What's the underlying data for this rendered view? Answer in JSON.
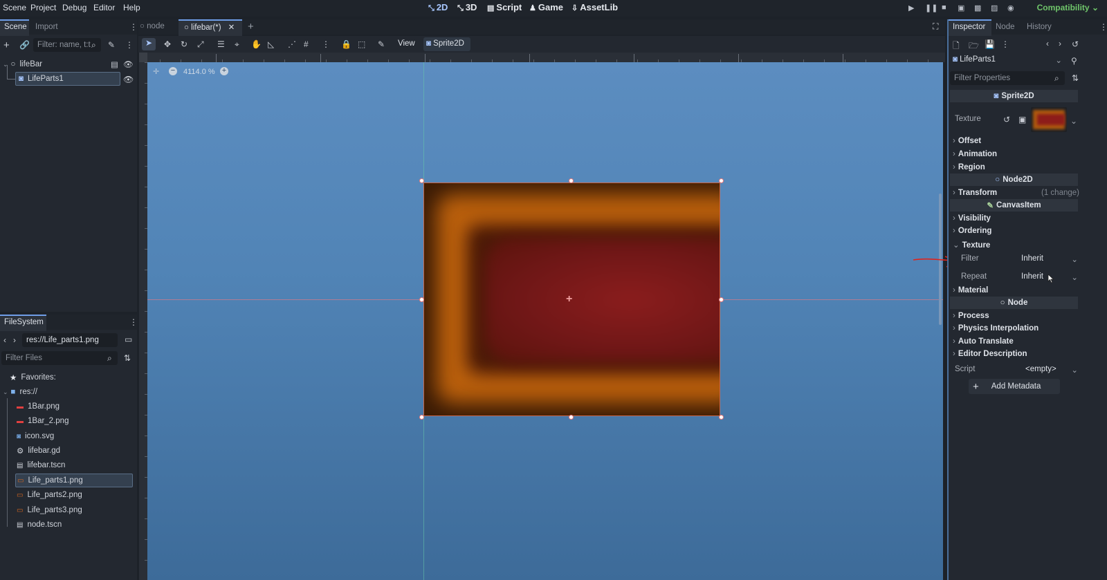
{
  "menu": [
    "Scene",
    "Project",
    "Debug",
    "Editor",
    "Help"
  ],
  "workspaces": [
    {
      "label": "2D",
      "icon": "2d-icon",
      "active": true
    },
    {
      "label": "3D",
      "icon": "3d-icon",
      "active": false
    },
    {
      "label": "Script",
      "icon": "script-icon",
      "active": false
    },
    {
      "label": "Game",
      "icon": "game-icon",
      "active": false
    },
    {
      "label": "AssetLib",
      "icon": "assetlib-icon",
      "active": false
    }
  ],
  "renderer": "Compatibility",
  "scene_dock": {
    "tabs": [
      "Scene",
      "Import"
    ],
    "filter_placeholder": "Filter: name, t:t",
    "tree": [
      {
        "label": "lifeBar",
        "icon": "node-icon",
        "level": 0
      },
      {
        "label": "LifeParts1",
        "icon": "sprite2d-icon",
        "level": 1,
        "selected": true
      }
    ]
  },
  "filesystem": {
    "tab": "FileSystem",
    "path": "res://Life_parts1.png",
    "filter_placeholder": "Filter Files",
    "favorites_label": "Favorites:",
    "root_label": "res://",
    "files": [
      {
        "name": "1Bar.png",
        "icon": "image-icon"
      },
      {
        "name": "1Bar_2.png",
        "icon": "image-icon"
      },
      {
        "name": "icon.svg",
        "icon": "svg-icon"
      },
      {
        "name": "lifebar.gd",
        "icon": "gear-icon"
      },
      {
        "name": "lifebar.tscn",
        "icon": "scene-icon"
      },
      {
        "name": "Life_parts1.png",
        "icon": "image-icon",
        "selected": true
      },
      {
        "name": "Life_parts2.png",
        "icon": "image-icon"
      },
      {
        "name": "Life_parts3.png",
        "icon": "image-icon"
      },
      {
        "name": "node.tscn",
        "icon": "scene-icon"
      }
    ]
  },
  "editor_tabs": [
    {
      "label": "node",
      "active": false
    },
    {
      "label": "lifebar(*)",
      "active": true
    }
  ],
  "toolbar": {
    "view_label": "View",
    "node_label": "Sprite2D"
  },
  "zoom": {
    "value": "4114.0 %"
  },
  "inspector": {
    "tabs": [
      "Inspector",
      "Node",
      "History"
    ],
    "node_name": "LifeParts1",
    "filter_placeholder": "Filter Properties",
    "sections": {
      "sprite2d": "Sprite2D",
      "node2d": "Node2D",
      "canvasitem": "CanvasItem",
      "node": "Node"
    },
    "texture_label": "Texture",
    "groups": {
      "offset": "Offset",
      "animation": "Animation",
      "region": "Region",
      "transform": "Transform",
      "transform_note": "(1 change)",
      "visibility": "Visibility",
      "ordering": "Ordering",
      "texture": "Texture",
      "material": "Material",
      "process": "Process",
      "physics_interpolation": "Physics Interpolation",
      "auto_translate": "Auto Translate",
      "editor_description": "Editor Description"
    },
    "filter_label": "Filter",
    "filter_value": "Inherit",
    "repeat_label": "Repeat",
    "repeat_value": "Inherit",
    "script_label": "Script",
    "script_value": "<empty>",
    "add_metadata_label": "Add Metadata"
  },
  "colors": {
    "accent": "#a8c7ff",
    "renderer": "#6fc56a",
    "viewport": "#4f82b4"
  }
}
